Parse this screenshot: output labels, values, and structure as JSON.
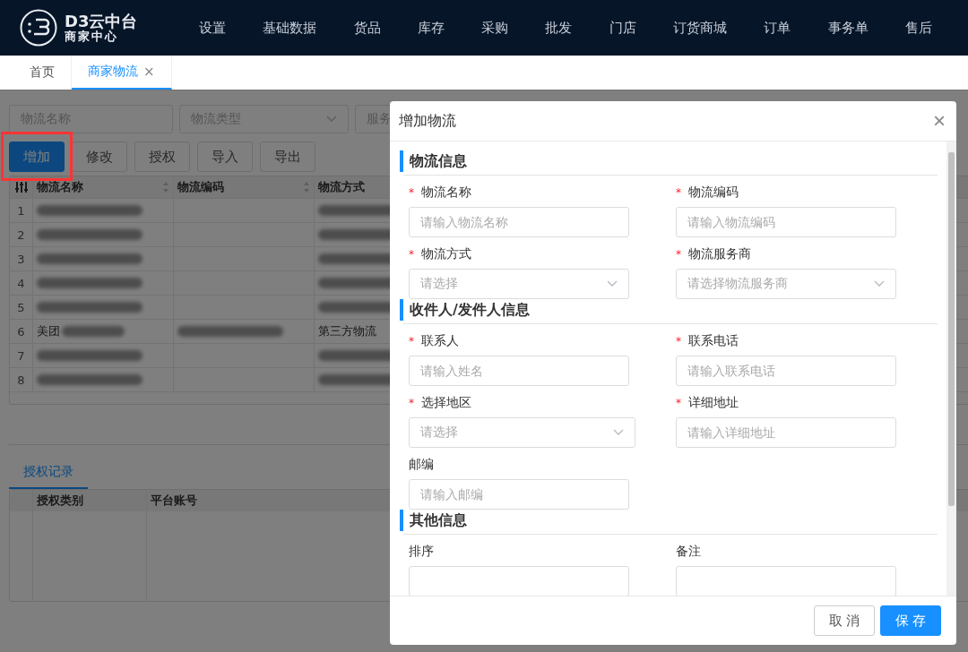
{
  "header": {
    "logo_title": "D3云中台",
    "logo_subtitle": "商家中心",
    "nav": [
      "设置",
      "基础数据",
      "货品",
      "库存",
      "采购",
      "批发",
      "门店",
      "订货商城",
      "订单",
      "事务单",
      "售后"
    ]
  },
  "page_tabs": [
    {
      "label": "首页",
      "selected": false,
      "closable": false
    },
    {
      "label": "商家物流",
      "selected": true,
      "closable": true,
      "close_glyph": "×"
    }
  ],
  "filters": [
    {
      "kind": "input",
      "placeholder": "物流名称"
    },
    {
      "kind": "select",
      "placeholder": "物流类型"
    },
    {
      "kind": "input",
      "placeholder": "服务"
    }
  ],
  "toolbar": [
    {
      "label": "增加",
      "primary": true,
      "highlighted": true
    },
    {
      "label": "修改",
      "primary": false,
      "highlighted": false
    },
    {
      "label": "授权",
      "primary": false,
      "highlighted": false
    },
    {
      "label": "导入",
      "primary": false,
      "highlighted": false
    },
    {
      "label": "导出",
      "primary": false,
      "highlighted": false
    }
  ],
  "table": {
    "columns": [
      {
        "label": "物流名称",
        "sortable": true
      },
      {
        "label": "物流编码",
        "sortable": true
      },
      {
        "label": "物流方式"
      }
    ],
    "rows": [
      {
        "index": "1",
        "cells": [
          {
            "kind": "redacted"
          },
          {
            "kind": "empty"
          },
          {
            "kind": "redacted"
          }
        ]
      },
      {
        "index": "2",
        "cells": [
          {
            "kind": "redacted"
          },
          {
            "kind": "empty"
          },
          {
            "kind": "redacted"
          }
        ]
      },
      {
        "index": "3",
        "cells": [
          {
            "kind": "redacted"
          },
          {
            "kind": "empty"
          },
          {
            "kind": "redacted"
          }
        ]
      },
      {
        "index": "4",
        "cells": [
          {
            "kind": "redacted"
          },
          {
            "kind": "empty"
          },
          {
            "kind": "redacted"
          }
        ]
      },
      {
        "index": "5",
        "cells": [
          {
            "kind": "redacted"
          },
          {
            "kind": "empty"
          },
          {
            "kind": "redacted"
          }
        ]
      },
      {
        "index": "6",
        "cells": [
          {
            "kind": "partial",
            "text": "美团"
          },
          {
            "kind": "redacted"
          },
          {
            "kind": "text",
            "text": "第三方物流"
          }
        ]
      },
      {
        "index": "7",
        "cells": [
          {
            "kind": "redacted"
          },
          {
            "kind": "empty"
          },
          {
            "kind": "redacted"
          }
        ]
      },
      {
        "index": "8",
        "cells": [
          {
            "kind": "redacted"
          },
          {
            "kind": "empty"
          },
          {
            "kind": "redacted"
          }
        ]
      }
    ]
  },
  "records": {
    "tabs": [
      {
        "label": "授权记录",
        "selected": true
      }
    ],
    "columns": [
      "授权类别",
      "平台账号"
    ]
  },
  "dialog": {
    "title": "增加物流",
    "close_glyph": "×",
    "required_mark": "*",
    "sections": [
      {
        "title": "物流信息",
        "fields": [
          {
            "label": "物流名称",
            "required": true,
            "kind": "input",
            "placeholder": "请输入物流名称"
          },
          {
            "label": "物流编码",
            "required": true,
            "kind": "input",
            "placeholder": "请输入物流编码"
          },
          {
            "label": "物流方式",
            "required": true,
            "kind": "select",
            "placeholder": "请选择"
          },
          {
            "label": "物流服务商",
            "required": true,
            "kind": "select",
            "placeholder": "请选择物流服务商"
          }
        ]
      },
      {
        "title": "收件人/发件人信息",
        "fields": [
          {
            "label": "联系人",
            "required": true,
            "kind": "input",
            "placeholder": "请输入姓名"
          },
          {
            "label": "联系电话",
            "required": true,
            "kind": "input",
            "placeholder": "请输入联系电话"
          },
          {
            "label": "选择地区",
            "required": true,
            "kind": "select",
            "placeholder": "请选择"
          },
          {
            "label": "详细地址",
            "required": true,
            "kind": "input",
            "placeholder": "请输入详细地址"
          },
          {
            "label": "邮编",
            "required": false,
            "kind": "input",
            "placeholder": "请输入邮编"
          }
        ]
      },
      {
        "title": "其他信息",
        "fields": [
          {
            "label": "排序",
            "required": false,
            "kind": "input"
          },
          {
            "label": "备注",
            "required": false,
            "kind": "input"
          }
        ]
      }
    ],
    "buttons": [
      {
        "label": "取 消",
        "primary": false
      },
      {
        "label": "保 存",
        "primary": true
      }
    ]
  }
}
